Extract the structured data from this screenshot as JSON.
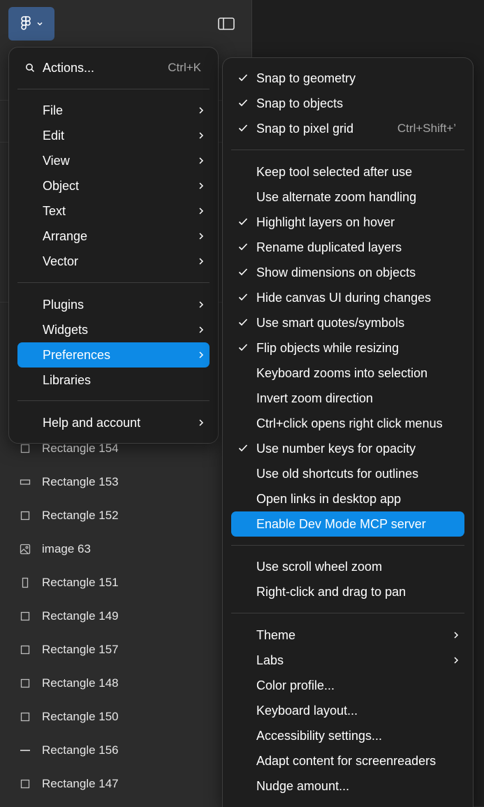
{
  "colors": {
    "sidebar_bg": "#2c2c2c",
    "menu_bg": "#1e1e1e",
    "accent": "#0d8ae6",
    "logo_button_bg": "#3a5a86",
    "shortcut_text": "#a6a6a6"
  },
  "toolbar": {
    "logo_icon": "figma-logo-icon",
    "dropdown_icon": "chevron-down-icon",
    "panel_toggle_icon": "sidebar-panel-icon"
  },
  "main_menu": {
    "actions": {
      "label": "Actions...",
      "shortcut": "Ctrl+K",
      "icon": "search-icon"
    },
    "items": [
      {
        "label": "File",
        "submenu": true
      },
      {
        "label": "Edit",
        "submenu": true
      },
      {
        "label": "View",
        "submenu": true
      },
      {
        "label": "Object",
        "submenu": true
      },
      {
        "label": "Text",
        "submenu": true
      },
      {
        "label": "Arrange",
        "submenu": true
      },
      {
        "label": "Vector",
        "submenu": true
      },
      {
        "label": "Plugins",
        "submenu": true
      },
      {
        "label": "Widgets",
        "submenu": true
      },
      {
        "label": "Preferences",
        "submenu": true,
        "active": true
      },
      {
        "label": "Libraries",
        "submenu": false
      },
      {
        "label": "Help and account",
        "submenu": true
      }
    ]
  },
  "preferences_menu": {
    "items": [
      {
        "label": "Snap to geometry",
        "checked": true
      },
      {
        "label": "Snap to objects",
        "checked": true
      },
      {
        "label": "Snap to pixel grid",
        "checked": true,
        "shortcut": "Ctrl+Shift+’"
      },
      {
        "label": "Keep tool selected after use",
        "checked": false
      },
      {
        "label": "Use alternate zoom handling",
        "checked": false
      },
      {
        "label": "Highlight layers on hover",
        "checked": true
      },
      {
        "label": "Rename duplicated layers",
        "checked": true
      },
      {
        "label": "Show dimensions on objects",
        "checked": true
      },
      {
        "label": "Hide canvas UI during changes",
        "checked": true
      },
      {
        "label": "Use smart quotes/symbols",
        "checked": true
      },
      {
        "label": "Flip objects while resizing",
        "checked": true
      },
      {
        "label": "Keyboard zooms into selection",
        "checked": false
      },
      {
        "label": "Invert zoom direction",
        "checked": false
      },
      {
        "label": "Ctrl+click opens right click menus",
        "checked": false
      },
      {
        "label": "Use number keys for opacity",
        "checked": true
      },
      {
        "label": "Use old shortcuts for outlines",
        "checked": false
      },
      {
        "label": "Open links in desktop app",
        "checked": false
      },
      {
        "label": "Enable Dev Mode MCP server",
        "checked": false,
        "active": true
      },
      {
        "label": "Use scroll wheel zoom",
        "checked": false
      },
      {
        "label": "Right-click and drag to pan",
        "checked": false
      },
      {
        "label": "Theme",
        "submenu": true
      },
      {
        "label": "Labs",
        "submenu": true
      },
      {
        "label": "Color profile...",
        "submenu": false
      },
      {
        "label": "Keyboard layout...",
        "submenu": false
      },
      {
        "label": "Accessibility settings...",
        "submenu": false
      },
      {
        "label": "Adapt content for screenreaders",
        "submenu": false
      },
      {
        "label": "Nudge amount...",
        "submenu": false
      }
    ]
  },
  "layers": [
    {
      "name": "Rectangle 154",
      "icon": "rectangle-icon"
    },
    {
      "name": "Rectangle 153",
      "icon": "wide-rectangle-icon"
    },
    {
      "name": "Rectangle 152",
      "icon": "rectangle-icon"
    },
    {
      "name": "image 63",
      "icon": "image-icon"
    },
    {
      "name": "Rectangle 151",
      "icon": "tall-rectangle-icon"
    },
    {
      "name": "Rectangle 149",
      "icon": "rectangle-icon"
    },
    {
      "name": "Rectangle 157",
      "icon": "rectangle-icon"
    },
    {
      "name": "Rectangle 148",
      "icon": "rectangle-icon"
    },
    {
      "name": "Rectangle 150",
      "icon": "rectangle-icon"
    },
    {
      "name": "Rectangle 156",
      "icon": "line-icon"
    },
    {
      "name": "Rectangle 147",
      "icon": "rectangle-icon"
    }
  ]
}
